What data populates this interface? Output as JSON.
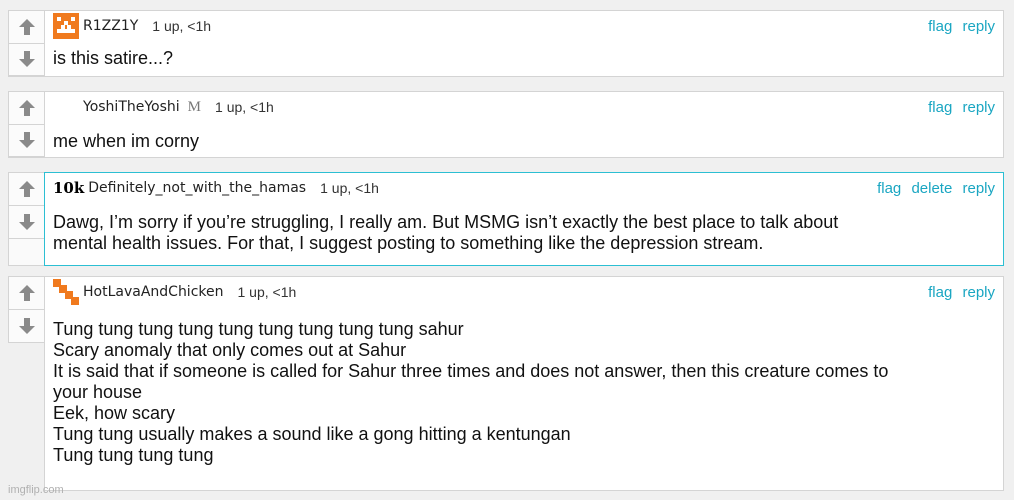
{
  "arrow_color": "#8a8a8a",
  "link_color": "#1aa6c2",
  "comments": [
    {
      "username": "R1ZZ1Y",
      "meta": "1 up, <1h",
      "actions": [
        "flag",
        "reply"
      ],
      "text": "is this satire...?"
    },
    {
      "username": "YoshiTheYoshi",
      "badge": "M",
      "meta": "1 up, <1h",
      "actions": [
        "flag",
        "reply"
      ],
      "text": "me when im corny"
    },
    {
      "prefix": "10k",
      "username": "Definitely_not_with_the_hamas",
      "meta": "1 up, <1h",
      "actions": [
        "flag",
        "delete",
        "reply"
      ],
      "text": "Dawg, I’m sorry if you’re struggling, I really am. But MSMG isn’t exactly the best place to talk about\nmental health issues. For that, I suggest posting to something like the depression stream."
    },
    {
      "username": "HotLavaAndChicken",
      "meta": "1 up, <1h",
      "actions": [
        "flag",
        "reply"
      ],
      "text": "Tung tung tung tung tung tung tung tung tung sahur\nScary anomaly that only comes out at Sahur\nIt is said that if someone is called for Sahur three times and does not answer, then this creature comes to\nyour house\nEek, how scary\nTung tung usually makes a sound like a gong hitting a kentungan\nTung tung tung tung"
    }
  ],
  "watermark": "imgflip.com"
}
